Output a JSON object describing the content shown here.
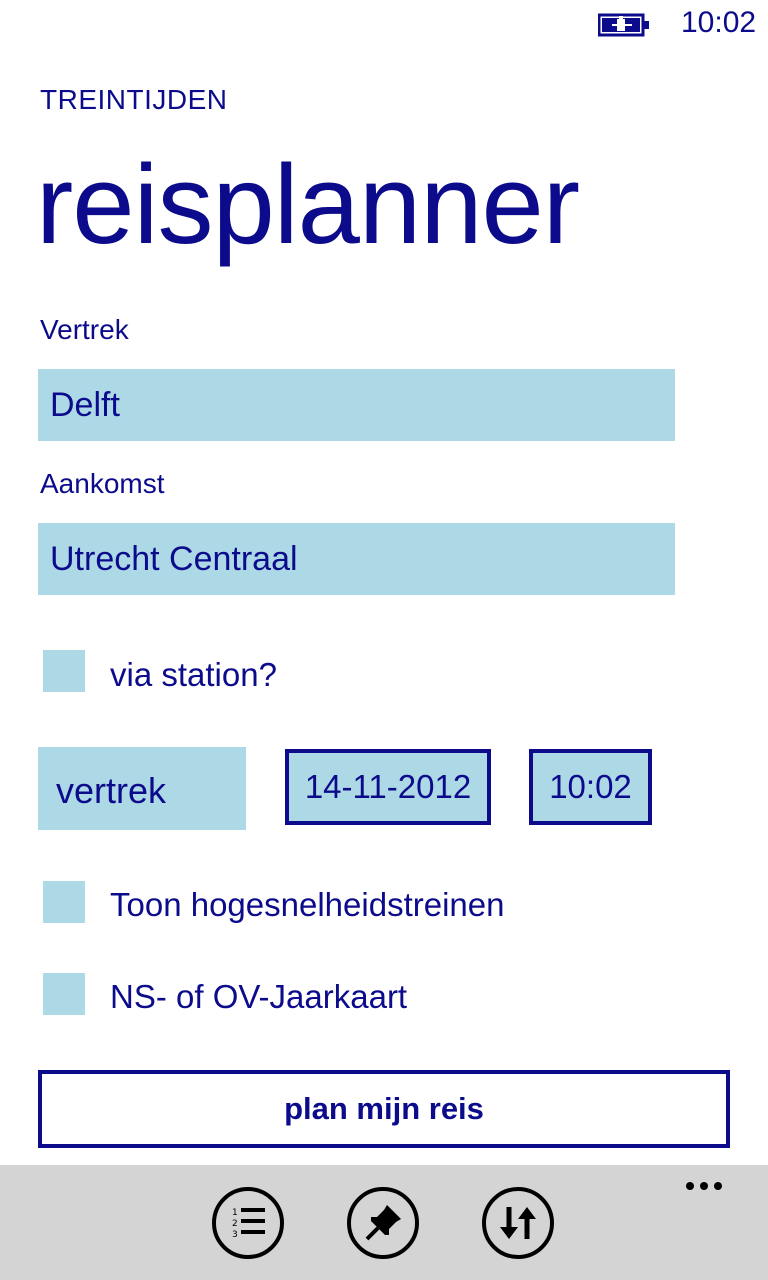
{
  "status_bar": {
    "time": "10:02",
    "battery_icon": "battery-charging-icon"
  },
  "app_title": "TREINTIJDEN",
  "page_title": "reisplanner",
  "departure": {
    "label": "Vertrek",
    "value": "Delft"
  },
  "arrival": {
    "label": "Aankomst",
    "value": "Utrecht Centraal"
  },
  "via_station": {
    "label": "via station?",
    "checked": false
  },
  "time_mode": {
    "selected": "vertrek"
  },
  "date": "14-11-2012",
  "time": "10:02",
  "high_speed": {
    "label": "Toon hogesnelheidstreinen",
    "checked": false
  },
  "yearcard": {
    "label": "NS- of OV-Jaarkaart",
    "checked": false
  },
  "plan_button": "plan mijn reis",
  "app_bar": {
    "buttons": [
      "list-icon",
      "pin-icon",
      "swap-arrows-icon"
    ],
    "more": "more-icon"
  },
  "colors": {
    "accent": "#0b0b8c",
    "field_bg": "#add8e6",
    "appbar_bg": "#d4d4d4"
  }
}
